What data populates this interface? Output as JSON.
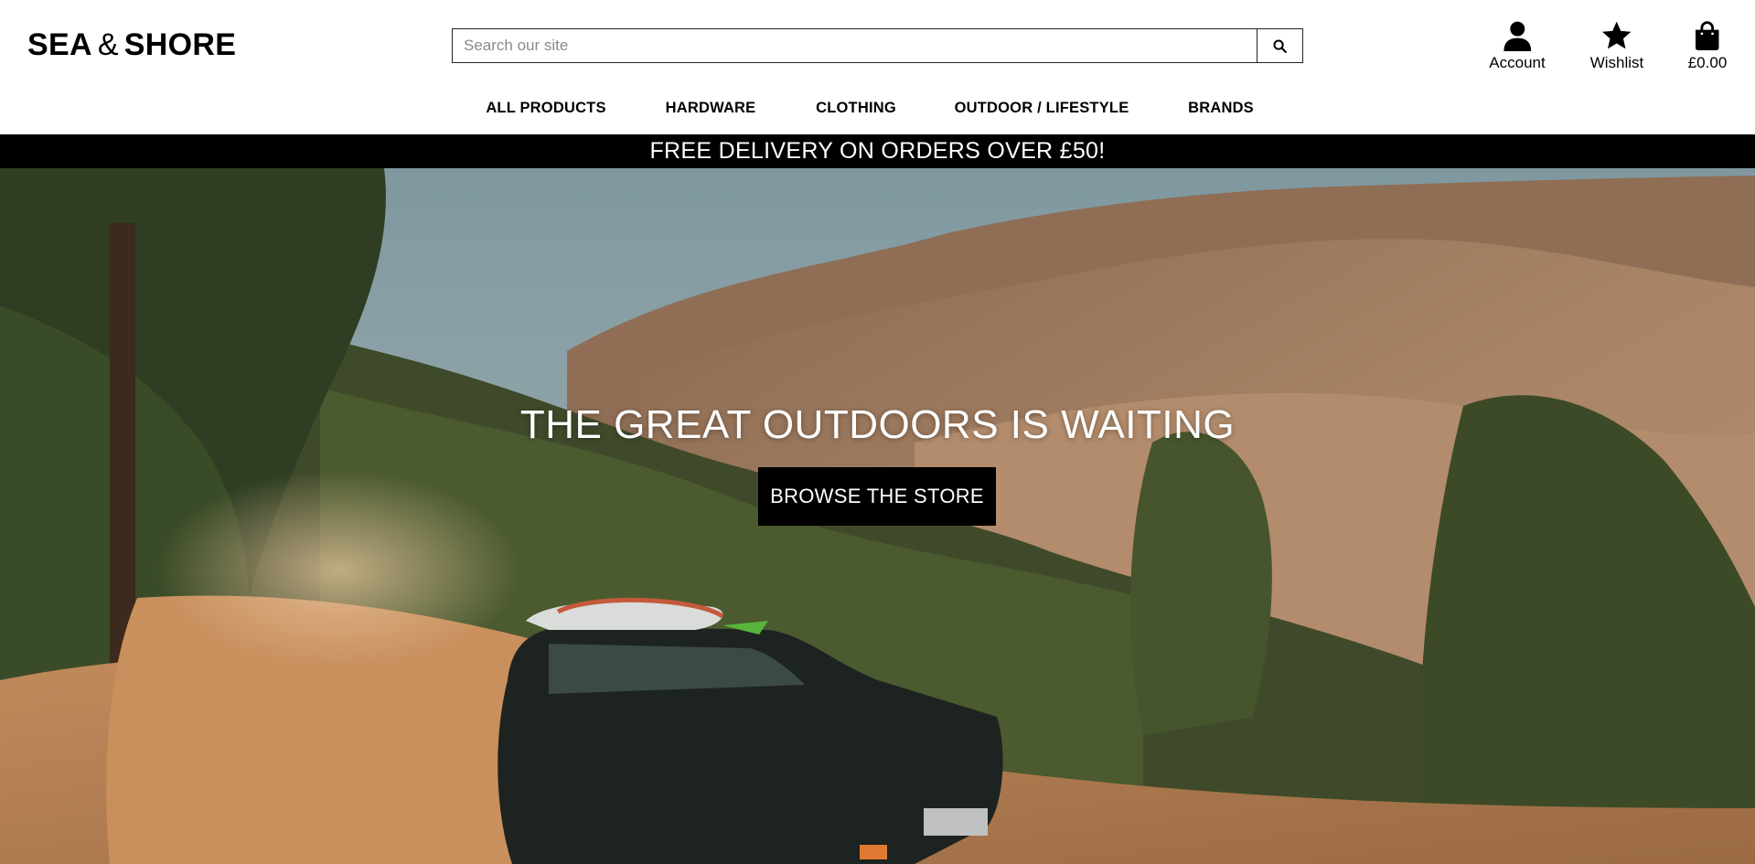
{
  "header": {
    "logo": {
      "part1": "SEA",
      "amp": "&",
      "part2": "SHORE"
    },
    "search": {
      "placeholder": "Search our site",
      "value": "",
      "button_icon": "search-icon"
    },
    "account": {
      "label": "Account",
      "icon": "user-icon"
    },
    "wishlist": {
      "label": "Wishlist",
      "icon": "star-icon"
    },
    "cart": {
      "total": "£0.00",
      "icon": "shopping-bag-icon"
    }
  },
  "nav": {
    "items": [
      {
        "label": "ALL PRODUCTS"
      },
      {
        "label": "HARDWARE"
      },
      {
        "label": "CLOTHING"
      },
      {
        "label": "OUTDOOR / LIFESTYLE"
      },
      {
        "label": "BRANDS"
      }
    ]
  },
  "promo": {
    "text": "FREE DELIVERY ON ORDERS OVER £50!"
  },
  "hero": {
    "title": "THE GREAT OUTDOORS IS WAITING",
    "cta_label": "BROWSE THE STORE"
  },
  "colors": {
    "primary": "#000000",
    "background": "#ffffff",
    "promo_text": "#ffffff"
  }
}
